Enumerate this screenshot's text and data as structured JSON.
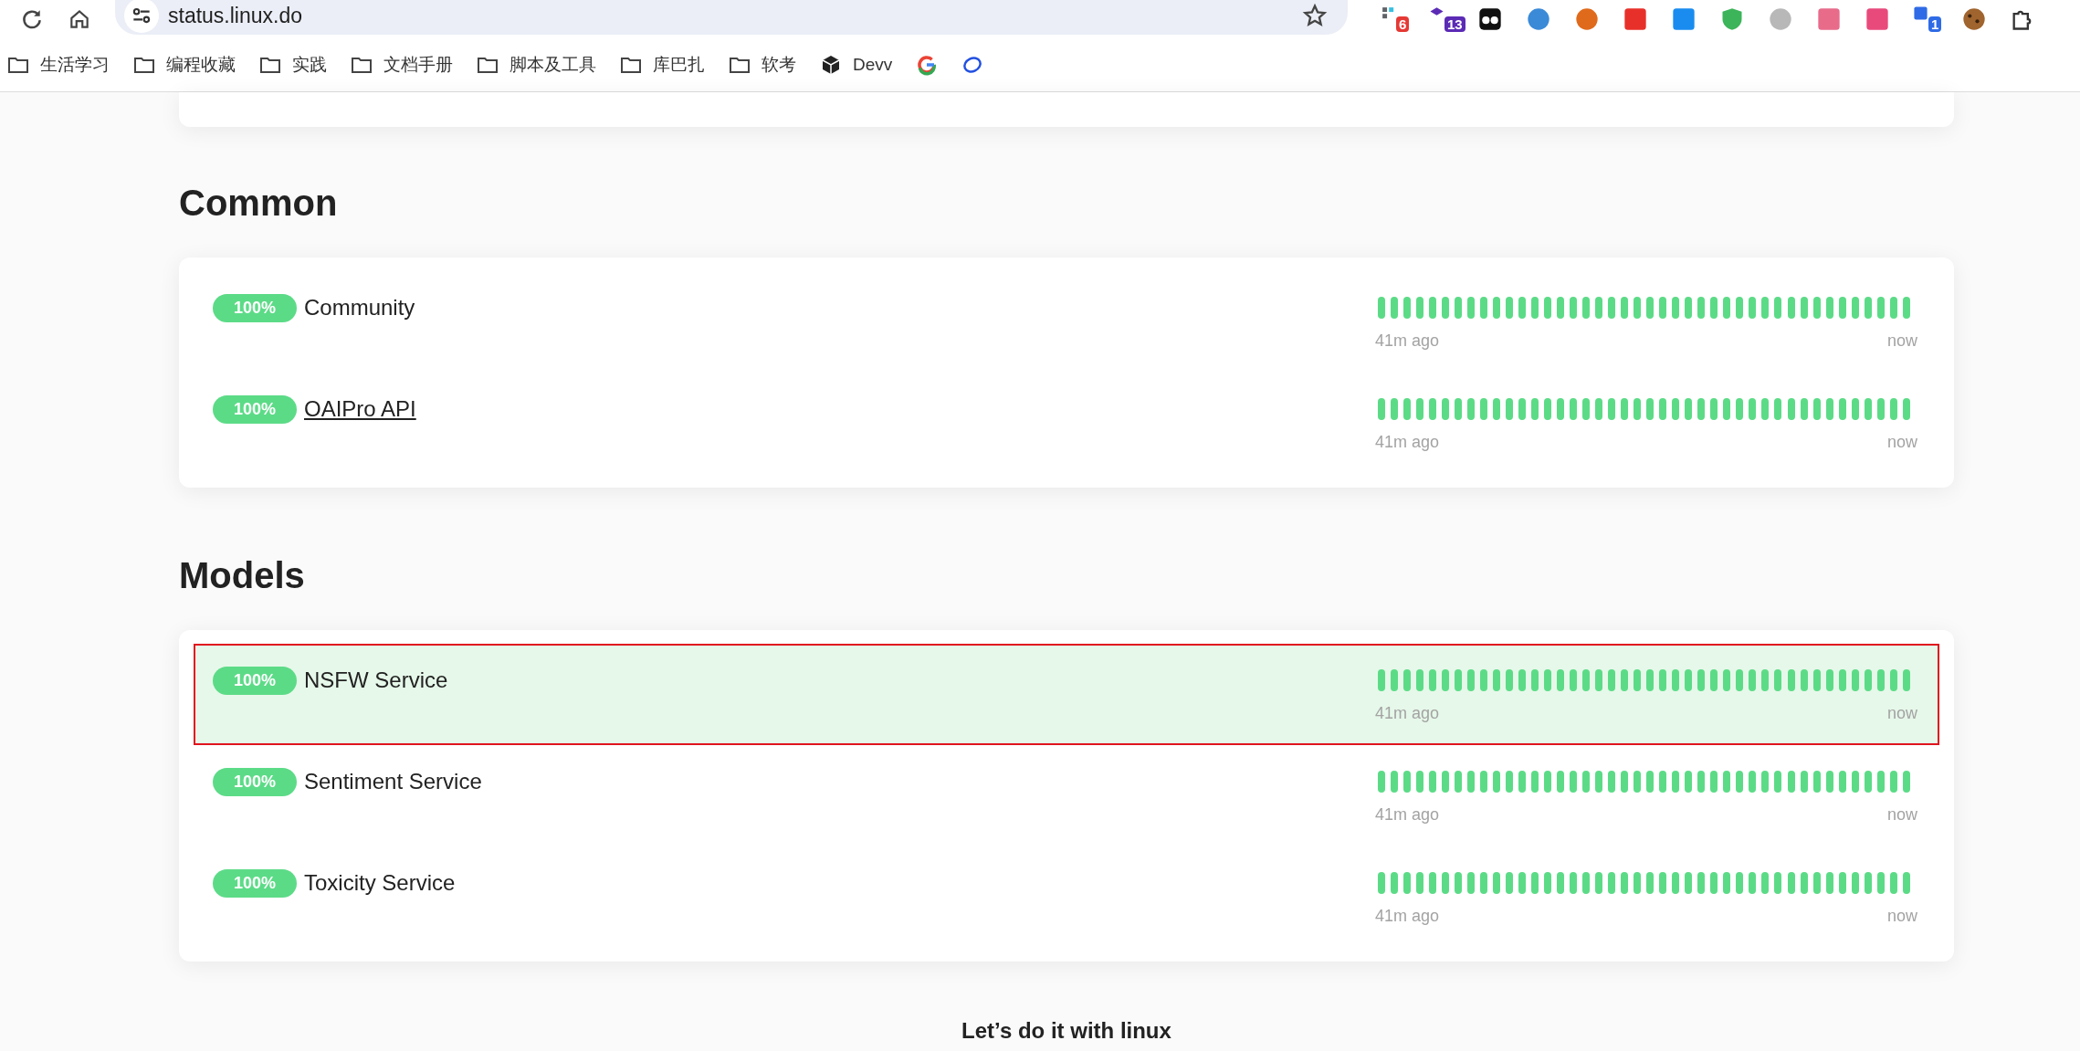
{
  "browser": {
    "url": "status.linux.do",
    "extensions": [
      {
        "kind": "grid",
        "color": "#5f6368",
        "badge": "6"
      },
      {
        "kind": "cap",
        "color": "#5b2bb5",
        "badge": "13"
      },
      {
        "kind": "eyes",
        "color": "#111111"
      },
      {
        "kind": "circle",
        "color": "#3a8ad8"
      },
      {
        "kind": "circle",
        "color": "#e06a1b"
      },
      {
        "kind": "square",
        "color": "#e8302a"
      },
      {
        "kind": "square",
        "color": "#1a8cf0"
      },
      {
        "kind": "shield",
        "color": "#3cb45a"
      },
      {
        "kind": "circle",
        "color": "#b8b8b8"
      },
      {
        "kind": "square",
        "color": "#e86b8a"
      },
      {
        "kind": "square",
        "color": "#e84a7c"
      },
      {
        "kind": "square",
        "color": "#2f6be6",
        "badge": "1"
      },
      {
        "kind": "cookie",
        "color": "#a0642e"
      },
      {
        "kind": "puzzle",
        "color": "#333333"
      }
    ]
  },
  "bookmarks": [
    {
      "kind": "folder",
      "label": "生活学习"
    },
    {
      "kind": "folder",
      "label": "编程收藏"
    },
    {
      "kind": "folder",
      "label": "实践"
    },
    {
      "kind": "folder",
      "label": "文档手册"
    },
    {
      "kind": "folder",
      "label": "脚本及工具"
    },
    {
      "kind": "folder",
      "label": "库巴扎"
    },
    {
      "kind": "folder",
      "label": "软考"
    },
    {
      "kind": "cube",
      "label": "Devv"
    },
    {
      "kind": "google"
    },
    {
      "kind": "ring"
    }
  ],
  "sections": [
    {
      "title": "Common",
      "services": [
        {
          "uptime": "100%",
          "name": "Community",
          "link": false,
          "selected": false,
          "start": "41m ago",
          "end": "now"
        },
        {
          "uptime": "100%",
          "name": "OAIPro API",
          "link": true,
          "selected": false,
          "start": "41m ago",
          "end": "now"
        }
      ]
    },
    {
      "title": "Models",
      "services": [
        {
          "uptime": "100%",
          "name": "NSFW Service",
          "link": false,
          "selected": true,
          "start": "41m ago",
          "end": "now"
        },
        {
          "uptime": "100%",
          "name": "Sentiment Service",
          "link": false,
          "selected": false,
          "start": "41m ago",
          "end": "now"
        },
        {
          "uptime": "100%",
          "name": "Toxicity Service",
          "link": false,
          "selected": false,
          "start": "41m ago",
          "end": "now"
        }
      ]
    }
  ],
  "footer": "Let’s do it with linux"
}
